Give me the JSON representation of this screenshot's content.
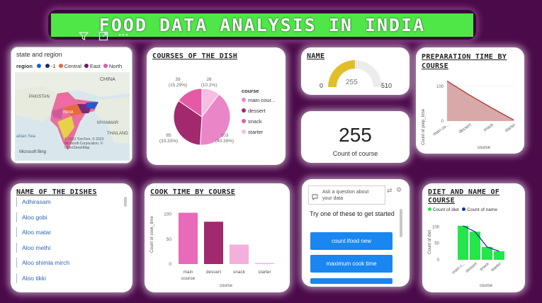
{
  "banner": {
    "title": "FOOD DATA ANALYSIS IN INDIA"
  },
  "colors": {
    "background": "#4b0a4a",
    "banner": "#4fe648",
    "accent_pink": "#e870b8"
  },
  "toolbar": {
    "icons": [
      "filter-icon",
      "focus-mode-icon",
      "more-options-icon"
    ],
    "more": "···"
  },
  "map": {
    "title": "state and region",
    "legend_label": "region",
    "legend": [
      {
        "label": "",
        "color": "#1c5cd6"
      },
      {
        "label": "-1",
        "color": "#1a2f70"
      },
      {
        "label": "Central",
        "color": "#e8693a"
      },
      {
        "label": "East",
        "color": "#6a1a6a"
      },
      {
        "label": "North",
        "color": "#e05aa8"
      }
    ],
    "labels": {
      "china": "CHINA",
      "pakistan": "PAKISTAN",
      "india": "INDIA",
      "myanmar": "MYANMAR",
      "thailand": "THAILAND",
      "arabian": "abian Sea"
    },
    "attribution": "© 2023 TomTom, © 2023 Microsoft Corporation, © OpenStreetMap",
    "brand": "Microsoft Bing"
  },
  "courses_pie": {
    "title": "COURSES OF THE DISH",
    "legend_title": "course",
    "labels": [
      {
        "value": "39",
        "pct": "(15.29%)"
      },
      {
        "value": "26",
        "pct": "(10.2%)"
      },
      {
        "value": "85",
        "pct": "(33.33%)"
      },
      {
        "value": "103",
        "pct": "(40.39%)"
      }
    ],
    "legend": [
      "main cour...",
      "dessert",
      "snack",
      "starter"
    ]
  },
  "chart_data": [
    {
      "type": "pie",
      "title": "COURSES OF THE DISH",
      "categories": [
        "main course",
        "dessert",
        "snack",
        "starter"
      ],
      "values": [
        103,
        85,
        39,
        26
      ],
      "percentages": [
        40.39,
        33.33,
        15.29,
        10.2
      ],
      "colors": [
        "#ea86c8",
        "#a3296e",
        "#e55aa6",
        "#f7bde3"
      ]
    },
    {
      "type": "gauge",
      "title": "NAME",
      "value": 255,
      "min": 0,
      "max": 510
    },
    {
      "type": "area",
      "title": "PREPARATION TIME BY COURSE",
      "categories": [
        "main co...",
        "dessert",
        "snack",
        "starter"
      ],
      "values": [
        115,
        75,
        38,
        3
      ],
      "xlabel": "course",
      "ylabel": "Count of prep_time",
      "yticks": [
        "0",
        "100"
      ],
      "ylim": [
        0,
        130
      ]
    },
    {
      "type": "bar",
      "title": "COOK TIME BY COURSE",
      "categories": [
        "main course",
        "dessert",
        "snack",
        "starter"
      ],
      "values": [
        103,
        85,
        39,
        2
      ],
      "xlabel": "course",
      "ylabel": "Count of cook_time",
      "yticks": [
        "0",
        "50",
        "100"
      ],
      "ylim": [
        0,
        125
      ],
      "colors": [
        "#e86ab8",
        "#a3296e",
        "#f4b0dc",
        "#f4b0dc"
      ]
    },
    {
      "type": "bar",
      "title": "DIET AND NAME OF COURSE",
      "categories": [
        "main c...",
        "dessert",
        "snack",
        "starter"
      ],
      "series": [
        {
          "name": "Count of diet",
          "values": [
            103,
            85,
            39,
            26
          ]
        },
        {
          "name": "Count of name",
          "values": [
            103,
            85,
            39,
            26
          ]
        }
      ],
      "xlabel": "course",
      "ylabel": "Count of diet",
      "yticks": [
        "0",
        "50",
        "100"
      ],
      "ylim": [
        0,
        120
      ]
    }
  ],
  "gauge": {
    "title": "NAME",
    "min_label": "0",
    "max_label": "510",
    "value_label": "255"
  },
  "kpi": {
    "value": "255",
    "caption": "Count of course"
  },
  "prep": {
    "title": "PREPARATION TIME BY COURSE",
    "ylabel": "Count of prep_time",
    "xlabel": "course"
  },
  "dishes": {
    "title": "NAME OF THE DISHES",
    "items": [
      "Adhirasam",
      "Aloo gobi",
      "Aloo matar",
      "Aloo methi",
      "Aloo shimla mirch",
      "Aloo tikki"
    ]
  },
  "cook": {
    "title": "COOK TIME BY COURSE",
    "ylabel": "Count of cook_time",
    "xlabel": "course",
    "xlabels": [
      "main",
      "course",
      "dessert",
      "snack",
      "starter"
    ]
  },
  "qa": {
    "placeholder_line1": "Ask a question about",
    "placeholder_line2": "your data",
    "prompt": "Try one of these to get started",
    "suggestions": [
      "count ifood new",
      "maximum cook time"
    ]
  },
  "diet": {
    "title": "DIET AND NAME OF COURSE",
    "legend": [
      "Count of diet",
      "Count of name"
    ],
    "ylabel": "Count of diet",
    "xlabel": "course"
  }
}
